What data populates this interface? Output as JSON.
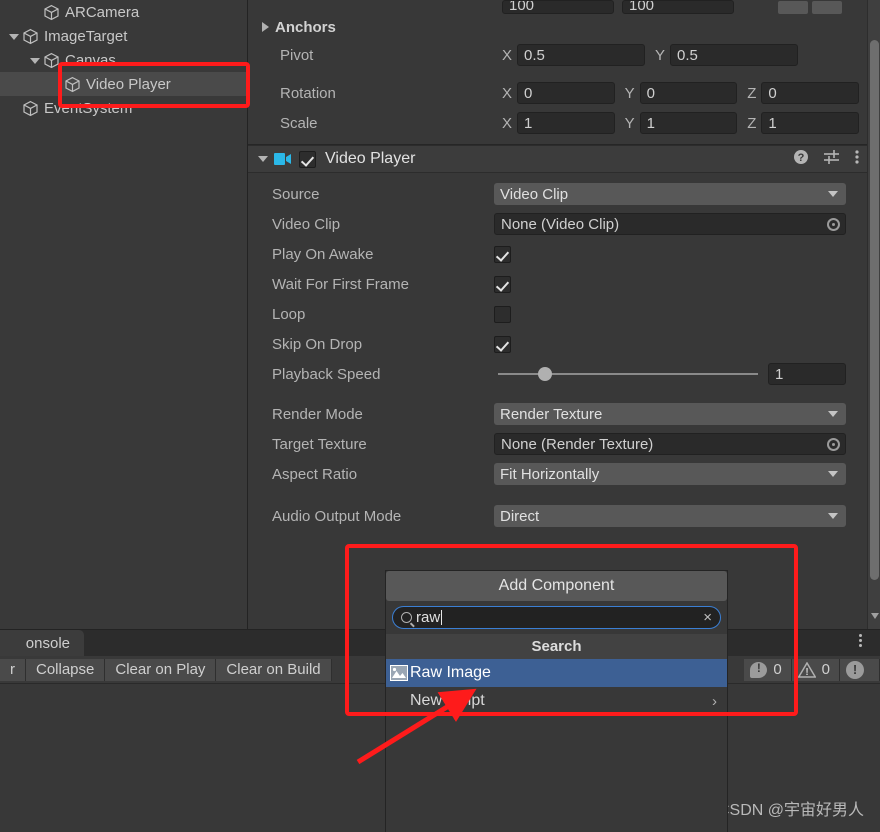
{
  "hierarchy": {
    "items": [
      {
        "label": "ARCamera",
        "indent": 1,
        "foldout": "none",
        "selected": false
      },
      {
        "label": "ImageTarget",
        "indent": 0,
        "foldout": "open",
        "selected": false
      },
      {
        "label": "Canvas",
        "indent": 1,
        "foldout": "open",
        "selected": false
      },
      {
        "label": "Video Player",
        "indent": 2,
        "foldout": "none",
        "selected": true
      },
      {
        "label": "EventSystem",
        "indent": 0,
        "foldout": "none",
        "selected": false
      }
    ]
  },
  "inspector": {
    "rect_transform": {
      "width_value": "100",
      "height_value": "100",
      "blueprint_label": "",
      "raw_label": "",
      "anchors_label": "Anchors",
      "pivot_label": "Pivot",
      "pivot_x": "0.5",
      "pivot_y": "0.5",
      "rotation_label": "Rotation",
      "rotation_x": "0",
      "rotation_y": "0",
      "rotation_z": "0",
      "scale_label": "Scale",
      "scale_x": "1",
      "scale_y": "1",
      "scale_z": "1",
      "axis_x": "X",
      "axis_y": "Y",
      "axis_z": "Z"
    },
    "video_player": {
      "title": "Video Player",
      "enabled": true,
      "help_icon": "help-icon",
      "preset_icon": "preset-icon",
      "menu_icon": "kebab-menu-icon",
      "fields": {
        "source_label": "Source",
        "source_value": "Video Clip",
        "video_clip_label": "Video Clip",
        "video_clip_value": "None (Video Clip)",
        "play_on_awake_label": "Play On Awake",
        "play_on_awake": true,
        "wait_first_frame_label": "Wait For First Frame",
        "wait_first_frame": true,
        "loop_label": "Loop",
        "loop": false,
        "skip_on_drop_label": "Skip On Drop",
        "skip_on_drop": true,
        "playback_speed_label": "Playback Speed",
        "playback_speed_value": "1",
        "playback_speed_percent": 18,
        "render_mode_label": "Render Mode",
        "render_mode_value": "Render Texture",
        "target_texture_label": "Target Texture",
        "target_texture_value": "None (Render Texture)",
        "aspect_ratio_label": "Aspect Ratio",
        "aspect_ratio_value": "Fit Horizontally",
        "audio_output_label": "Audio Output Mode",
        "audio_output_value": "Direct"
      }
    }
  },
  "add_component": {
    "button_label": "Add Component",
    "search_value": "raw",
    "search_icon": "search-icon",
    "clear_icon": "clear-icon",
    "section_title": "Search",
    "results": [
      {
        "label": "Raw Image",
        "icon": "raw-image-icon",
        "highlighted": true,
        "submenu": false
      },
      {
        "label": "New script",
        "icon": "none",
        "highlighted": false,
        "submenu": true
      }
    ],
    "chevron": "›"
  },
  "console": {
    "tab_label": "onsole",
    "menu_icon": "kebab-menu-icon",
    "toolbar": [
      {
        "label": "r"
      },
      {
        "label": "Collapse"
      },
      {
        "label": "Clear on Play"
      },
      {
        "label": "Clear on Build"
      }
    ],
    "counters": [
      {
        "icon": "message-icon",
        "count": "0"
      },
      {
        "icon": "warning-icon",
        "count": "0"
      },
      {
        "icon": "error-icon",
        "count": ""
      }
    ]
  },
  "watermark": "CSDN @宇宙好男人",
  "colors": {
    "window_bg": "#383838",
    "panel_bg": "#393939",
    "header_bg": "#3c3c3c",
    "field_bg": "#2a2a2a",
    "dropdown_bg": "#585858",
    "highlight_blue": "#3d6094",
    "focus_blue": "#3b7fd4",
    "annotation_red": "#fe1b1b",
    "text_primary": "#d2d2d2",
    "text_label": "#b4b4b4"
  }
}
